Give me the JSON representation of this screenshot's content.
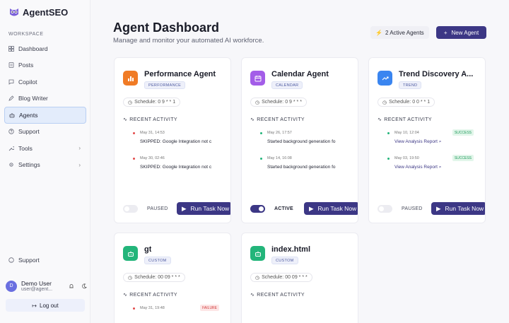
{
  "app": {
    "name": "AgentSEO"
  },
  "sidebar": {
    "section": "WORKSPACE",
    "items": [
      {
        "label": "Dashboard",
        "icon": "grid-icon"
      },
      {
        "label": "Posts",
        "icon": "document-icon"
      },
      {
        "label": "Copilot",
        "icon": "chat-icon"
      },
      {
        "label": "Blog Writer",
        "icon": "pen-icon"
      },
      {
        "label": "Agents",
        "icon": "robot-icon",
        "active": true
      },
      {
        "label": "Support",
        "icon": "help-icon"
      },
      {
        "label": "Tools",
        "icon": "wrench-icon",
        "expandable": true
      },
      {
        "label": "Settings",
        "icon": "gear-icon",
        "expandable": true
      }
    ],
    "support": "Support",
    "user": {
      "initial": "D",
      "name": "Demo User",
      "email": "user@agent..."
    },
    "logout": "Log out"
  },
  "header": {
    "title": "Agent Dashboard",
    "subtitle": "Manage and monitor your automated AI workforce.",
    "active_count": "2 Active Agents",
    "new_agent": "New Agent"
  },
  "colors": {
    "accent": "#3c3785",
    "orange": "#f07b25",
    "purple": "#a35de8",
    "blue": "#3a85f0",
    "green": "#23b57a"
  },
  "cards": [
    {
      "title": "Performance Agent",
      "tag": "PERFORMANCE",
      "icon": "bar-chart-icon",
      "schedule": "Schedule: 0 9 * * 1",
      "recent": "RECENT ACTIVITY",
      "activity": [
        {
          "time": "May 31, 14:53",
          "text": "SKIPPED: Google Integration not c",
          "dot": "#e34b4b"
        },
        {
          "time": "May 30, 02:46",
          "text": "SKIPPED: Google Integration not c",
          "dot": "#e34b4b"
        }
      ],
      "status": "PAUSED",
      "toggle": "off",
      "run": "Run Task Now"
    },
    {
      "title": "Calendar Agent",
      "tag": "CALENDAR",
      "icon": "calendar-icon",
      "schedule": "Schedule: 0 9 * * *",
      "recent": "RECENT ACTIVITY",
      "activity": [
        {
          "time": "May 26, 17:57",
          "text": "Started background generation fo",
          "dot": "#23b57a"
        },
        {
          "time": "May 14, 16:08",
          "text": "Started background generation fo",
          "dot": "#23b57a"
        }
      ],
      "status": "ACTIVE",
      "toggle": "on",
      "run": "Run Task Now"
    },
    {
      "title": "Trend Discovery A...",
      "tag": "TREND",
      "icon": "trend-icon",
      "schedule": "Schedule: 0 0 * * 1",
      "recent": "RECENT ACTIVITY",
      "activity": [
        {
          "time": "May 10, 12:04",
          "link": "View Analysis Report",
          "badge": "SUCCESS",
          "dot": "#23b57a"
        },
        {
          "time": "May 03, 19:50",
          "link": "View Analysis Report",
          "badge": "SUCCESS",
          "dot": "#23b57a"
        }
      ],
      "status": "PAUSED",
      "toggle": "off",
      "run": "Run Task Now"
    },
    {
      "title": "gt",
      "tag": "CUSTOM",
      "icon": "bot-icon",
      "schedule": "Schedule: 00 09 * * *",
      "recent": "RECENT ACTIVITY",
      "activity": [
        {
          "time": "May 31, 19:48",
          "badge": "FAILURE",
          "dot": "#e34b4b"
        }
      ]
    },
    {
      "title": "index.html",
      "tag": "CUSTOM",
      "icon": "bot-icon",
      "schedule": "Schedule: 00 09 * * *",
      "recent": "RECENT ACTIVITY",
      "activity": []
    }
  ]
}
